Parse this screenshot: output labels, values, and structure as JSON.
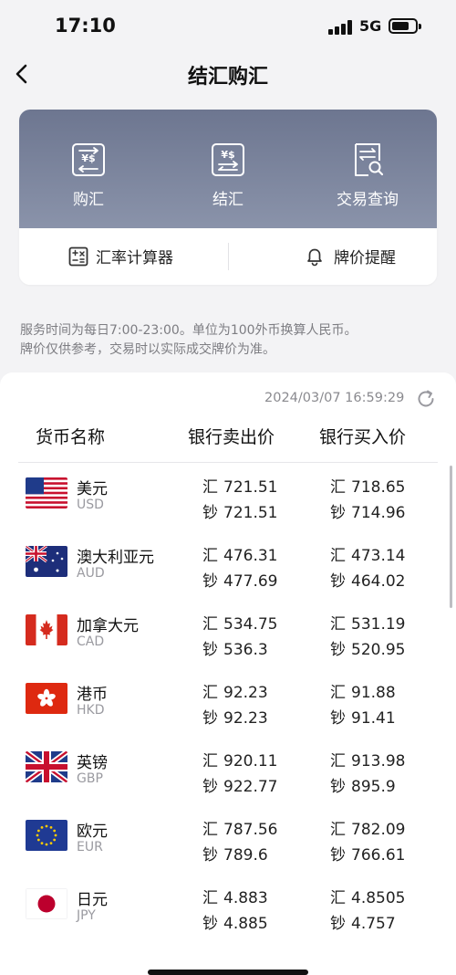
{
  "status_bar": {
    "time": "17:10",
    "network": "5G"
  },
  "nav": {
    "title": "结汇购汇"
  },
  "actions": [
    {
      "label": "购汇",
      "icon": "currency-exchange-icon"
    },
    {
      "label": "结汇",
      "icon": "currency-settle-icon"
    },
    {
      "label": "交易查询",
      "icon": "document-search-icon"
    }
  ],
  "tools": {
    "calculator_label": "汇率计算器",
    "alert_label": "牌价提醒"
  },
  "notice": {
    "line1": "服务时间为每日7:00-23:00。单位为100外币换算人民币。",
    "line2": "牌价仅供参考，交易时以实际成交牌价为准。"
  },
  "rates": {
    "updated_at": "2024/03/07 16:59:29",
    "headers": {
      "currency": "货币名称",
      "sell": "银行卖出价",
      "buy": "银行买入价"
    },
    "prefix_remit": "汇",
    "prefix_cash": "钞",
    "rows": [
      {
        "name": "美元",
        "code": "USD",
        "flag": "us-flag-icon",
        "sell_remit": "721.51",
        "sell_cash": "721.51",
        "buy_remit": "718.65",
        "buy_cash": "714.96"
      },
      {
        "name": "澳大利亚元",
        "code": "AUD",
        "flag": "au-flag-icon",
        "sell_remit": "476.31",
        "sell_cash": "477.69",
        "buy_remit": "473.14",
        "buy_cash": "464.02"
      },
      {
        "name": "加拿大元",
        "code": "CAD",
        "flag": "ca-flag-icon",
        "sell_remit": "534.75",
        "sell_cash": "536.3",
        "buy_remit": "531.19",
        "buy_cash": "520.95"
      },
      {
        "name": "港币",
        "code": "HKD",
        "flag": "hk-flag-icon",
        "sell_remit": "92.23",
        "sell_cash": "92.23",
        "buy_remit": "91.88",
        "buy_cash": "91.41"
      },
      {
        "name": "英镑",
        "code": "GBP",
        "flag": "gb-flag-icon",
        "sell_remit": "920.11",
        "sell_cash": "922.77",
        "buy_remit": "913.98",
        "buy_cash": "895.9"
      },
      {
        "name": "欧元",
        "code": "EUR",
        "flag": "eu-flag-icon",
        "sell_remit": "787.56",
        "sell_cash": "789.6",
        "buy_remit": "782.09",
        "buy_cash": "766.61"
      },
      {
        "name": "日元",
        "code": "JPY",
        "flag": "jp-flag-icon",
        "sell_remit": "4.883",
        "sell_cash": "4.885",
        "buy_remit": "4.8505",
        "buy_cash": "4.757"
      }
    ]
  }
}
